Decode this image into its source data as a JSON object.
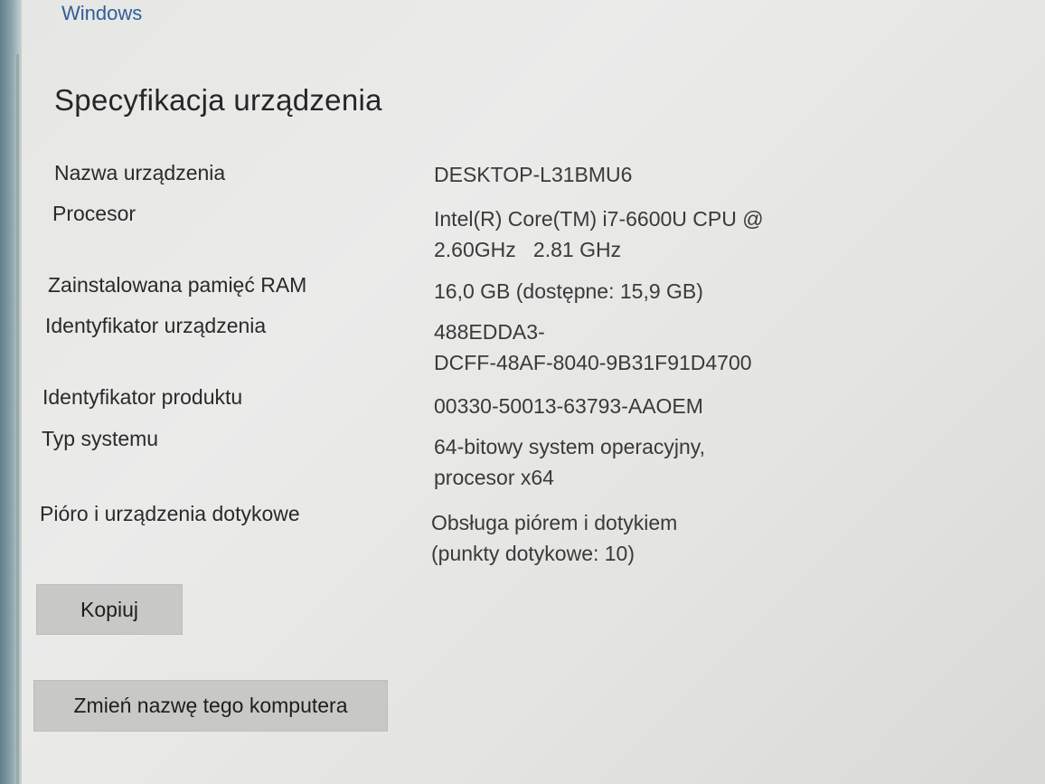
{
  "header": {
    "link_label": "Windows"
  },
  "section": {
    "title": "Specyfikacja urządzenia"
  },
  "specs": [
    {
      "label": "Nazwa urządzenia",
      "value_lines": [
        "DESKTOP-L31BMU6"
      ]
    },
    {
      "label": "Procesor",
      "value_lines": [
        "Intel(R) Core(TM) i7-6600U CPU @",
        "2.60GHz   2.81 GHz"
      ]
    },
    {
      "label": "Zainstalowana pamięć RAM",
      "value_lines": [
        "16,0 GB (dostępne: 15,9 GB)"
      ]
    },
    {
      "label": "Identyfikator urządzenia",
      "value_lines": [
        "488EDDA3-",
        "DCFF-48AF-8040-9B31F91D4700"
      ]
    },
    {
      "label": "Identyfikator produktu",
      "value_lines": [
        "00330-50013-63793-AAOEM"
      ]
    },
    {
      "label": "Typ systemu",
      "value_lines": [
        "64-bitowy system operacyjny,",
        "procesor x64"
      ]
    },
    {
      "label": "Pióro i urządzenia dotykowe",
      "value_lines": [
        "Obsługa piórem i dotykiem",
        "(punkty dotykowe: 10)"
      ]
    }
  ],
  "buttons": {
    "copy_label": "Kopiuj",
    "rename_label": "Zmień nazwę tego komputera"
  }
}
